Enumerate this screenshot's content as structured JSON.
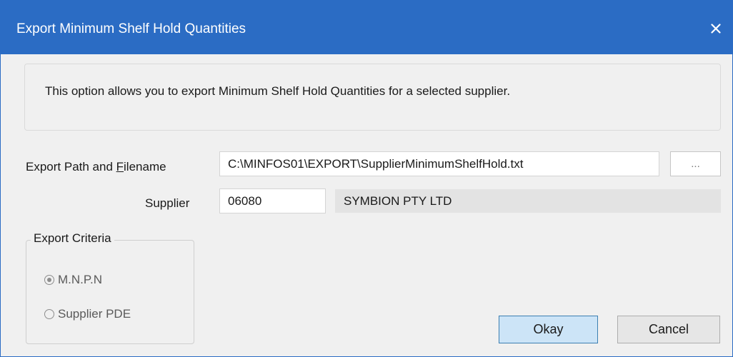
{
  "window": {
    "title": "Export Minimum Shelf Hold Quantities",
    "close_icon": "close-icon",
    "title_bar_color": "#2b6cc4"
  },
  "info": {
    "text": "This option allows you to export Minimum Shelf Hold Quantities for a selected supplier."
  },
  "export_path": {
    "label_before": "Export Path and ",
    "label_access": "F",
    "label_after": "ilename",
    "value": "C:\\MINFOS01\\EXPORT\\SupplierMinimumShelfHold.txt",
    "browse_label": "..."
  },
  "supplier": {
    "label": "Supplier",
    "code": "06080",
    "name": "SYMBION PTY LTD"
  },
  "criteria": {
    "title": "Export Criteria",
    "options": [
      {
        "label": "M.N.P.N",
        "selected": true
      },
      {
        "label": "Supplier PDE",
        "selected": false
      }
    ]
  },
  "buttons": {
    "okay": "Okay",
    "cancel": "Cancel"
  }
}
